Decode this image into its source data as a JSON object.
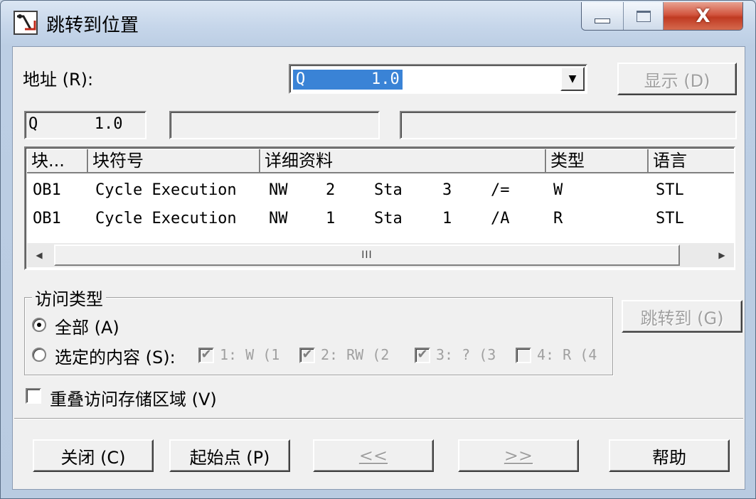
{
  "window": {
    "title": "跳转到位置",
    "close_glyph": "X",
    "icon": "app-icon"
  },
  "address": {
    "label": "地址 (R):",
    "value": "Q       1.0",
    "show_button": "显示 (D)"
  },
  "info_fields": {
    "field1": "Q      1.0",
    "field2": "",
    "field3": ""
  },
  "table": {
    "columns": [
      "块...",
      "块符号",
      "详细资料",
      "类型",
      "语言"
    ],
    "rows": [
      {
        "block": "OB1",
        "symbol": "Cycle Execution",
        "d1": "NW",
        "d2": "2",
        "d3": "Sta",
        "d4": "3",
        "d5": "/=",
        "type": "W",
        "lang": "STL"
      },
      {
        "block": "OB1",
        "symbol": "Cycle Execution",
        "d1": "NW",
        "d2": "1",
        "d3": "Sta",
        "d4": "1",
        "d5": "/A",
        "type": "R",
        "lang": "STL"
      }
    ],
    "scroll_thumb": "III"
  },
  "access_type": {
    "legend": "访问类型",
    "all_label": "全部 (A)",
    "selected_label": "选定的内容 (S):",
    "options": [
      {
        "label": "1: W (1",
        "checked": true
      },
      {
        "label": "2: RW (2",
        "checked": true
      },
      {
        "label": "3: ? (3",
        "checked": true
      },
      {
        "label": "4: R (4",
        "checked": false
      }
    ]
  },
  "jump_button": "跳转到 (G)",
  "overlap_label": "重叠访问存储区域 (V)",
  "bottom_buttons": {
    "close": "关闭 (C)",
    "start": "起始点 (P)",
    "prev": "<<",
    "next": ">>",
    "help": "帮助"
  },
  "colors": {
    "selection": "#3a83d6",
    "close_button": "#c03a22"
  }
}
